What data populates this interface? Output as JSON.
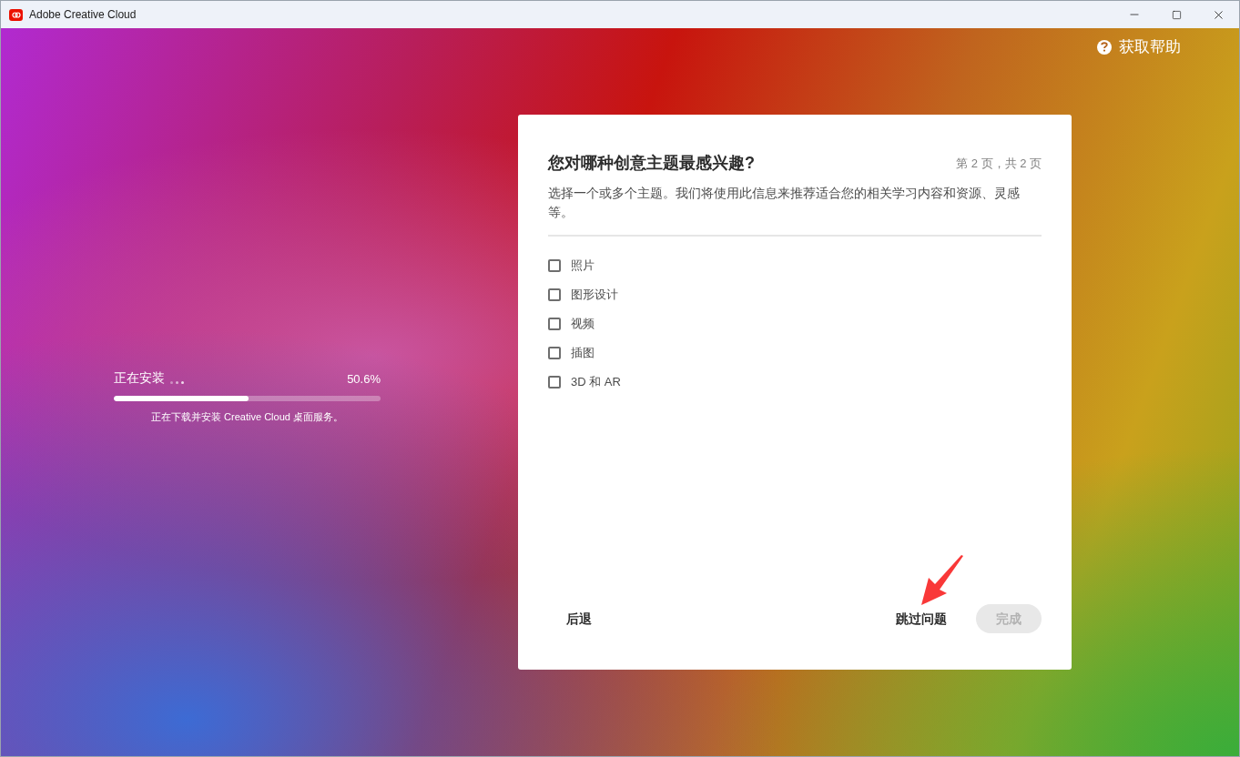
{
  "window": {
    "title": "Adobe Creative Cloud"
  },
  "help": {
    "label": "获取帮助"
  },
  "install": {
    "status": "正在安装",
    "percent": "50.6%",
    "level": 0.506,
    "message": "正在下载并安装 Creative Cloud 桌面服务。"
  },
  "dialog": {
    "title": "您对哪种创意主题最感兴趣?",
    "page": "第 2 页，共 2 页",
    "description": "选择一个或多个主题。我们将使用此信息来推荐适合您的相关学习内容和资源、灵感等。",
    "options": [
      {
        "label": "照片",
        "checked": false
      },
      {
        "label": "图形设计",
        "checked": false
      },
      {
        "label": "视频",
        "checked": false
      },
      {
        "label": "插图",
        "checked": false
      },
      {
        "label": "3D 和 AR",
        "checked": false
      }
    ],
    "back": "后退",
    "skip": "跳过问题",
    "finish": {
      "label": "完成",
      "disabled": true
    }
  }
}
